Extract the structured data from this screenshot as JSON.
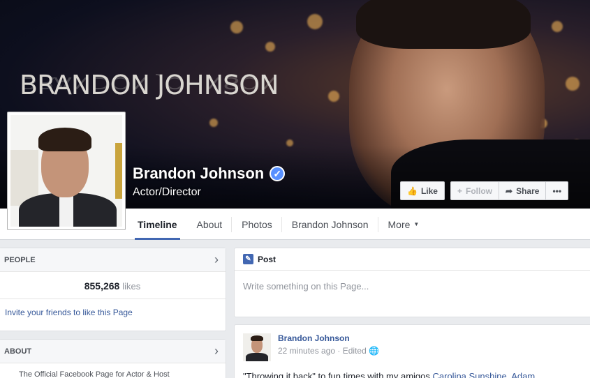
{
  "cover": {
    "title": "BRANDON JOHNSON"
  },
  "page": {
    "name": "Brandon Johnson",
    "verified_mark": "✓",
    "category": "Actor/Director"
  },
  "actions": {
    "like": {
      "label": "Like",
      "icon": "thumbs-up-icon"
    },
    "follow": {
      "label": "Follow",
      "icon": "plus-icon"
    },
    "share": {
      "label": "Share",
      "icon": "share-arrow-icon"
    },
    "more": {
      "label": "•••"
    }
  },
  "tabs": [
    {
      "label": "Timeline",
      "active": true
    },
    {
      "label": "About"
    },
    {
      "label": "Photos"
    },
    {
      "label": "Brandon Johnson"
    },
    {
      "label": "More",
      "caret": "▼"
    }
  ],
  "people": {
    "header": "PEOPLE",
    "count": "855,268",
    "unit": "likes",
    "invite": "Invite your friends to like this Page"
  },
  "about": {
    "header": "ABOUT",
    "text": "The Official Facebook Page for Actor & Host"
  },
  "composer": {
    "label": "Post",
    "placeholder": "Write something on this Page..."
  },
  "post": {
    "author": "Brandon Johnson",
    "time": "22 minutes ago",
    "edited": "Edited",
    "text_start": "\"Throwing it back\" to fun times with my amigos ",
    "text_link": "Carolina Sunshine, Adam"
  },
  "colors": {
    "link": "#365899",
    "accent": "#4267b2",
    "verified": "#5890ff"
  }
}
